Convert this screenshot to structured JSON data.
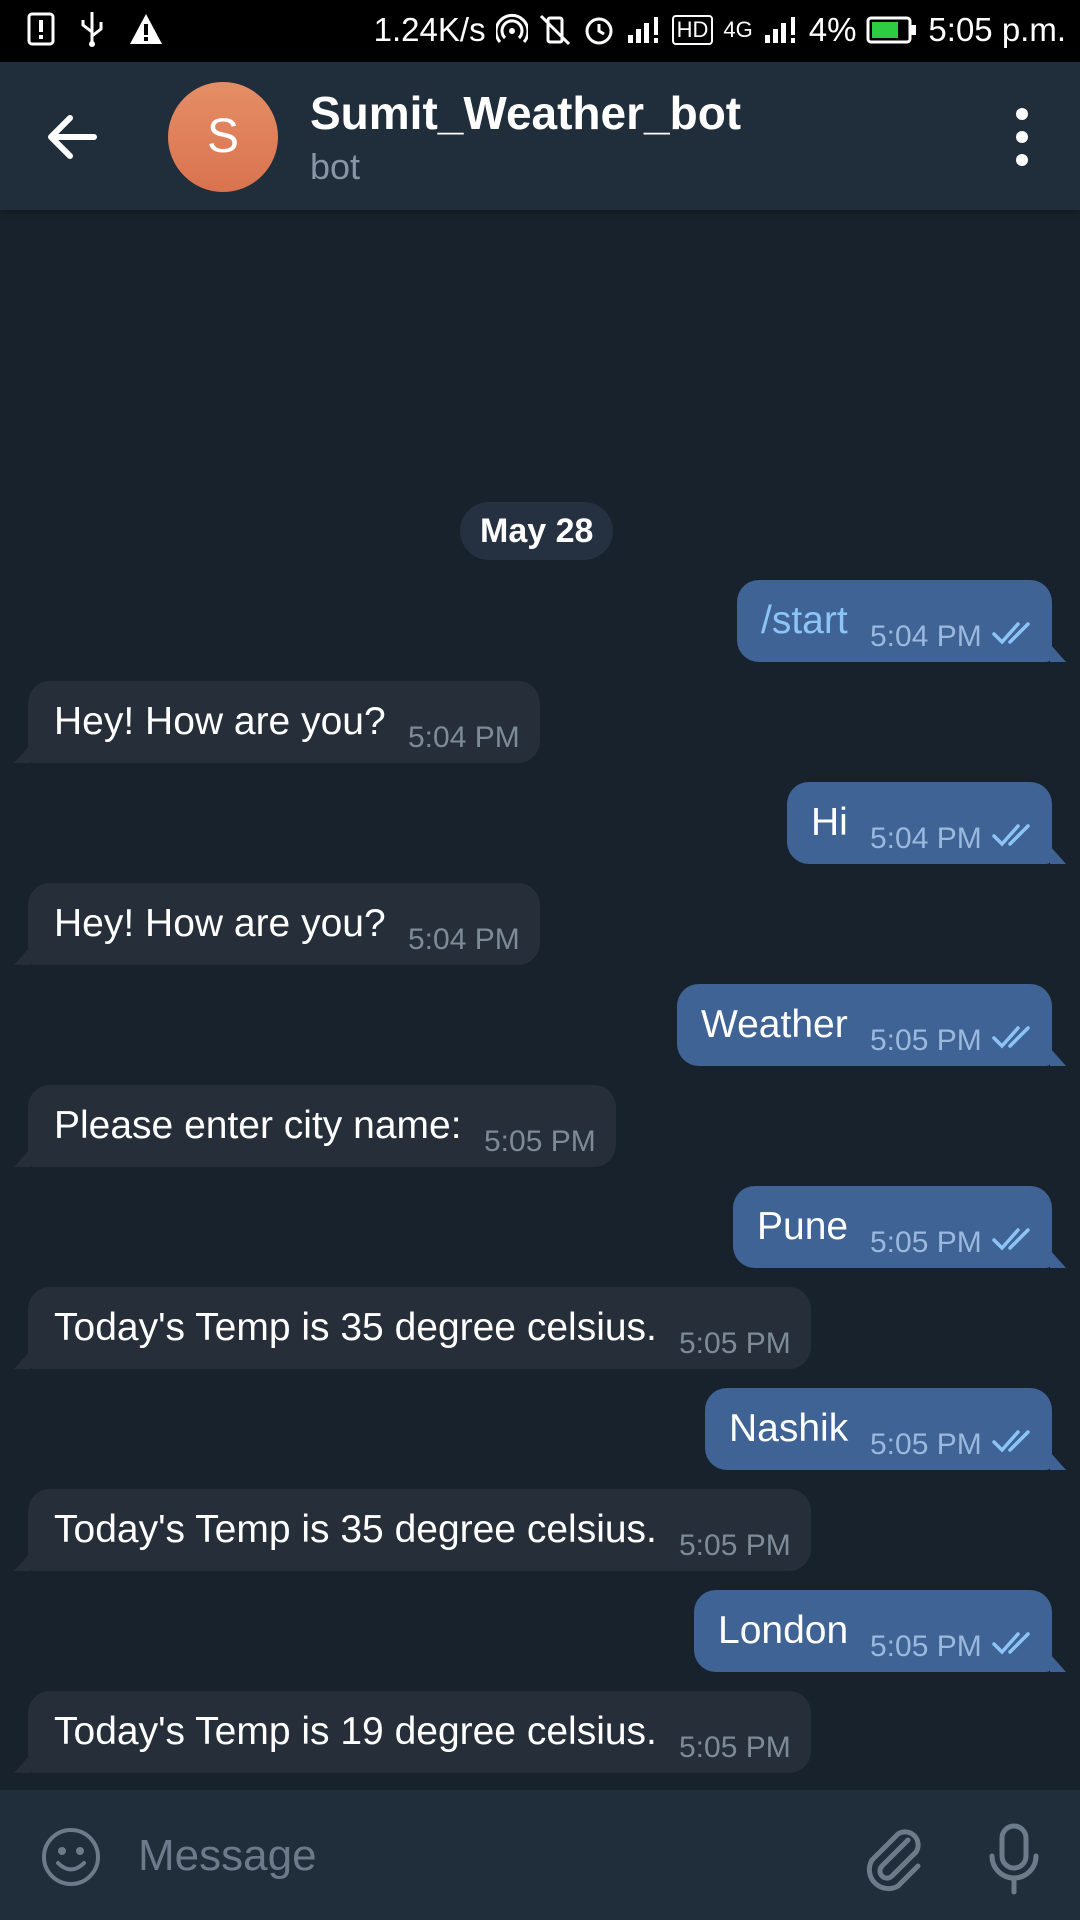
{
  "status_bar": {
    "speed": "1.24K/s",
    "battery_percent": "4%",
    "time": "5:05 p.m.",
    "network": "4G",
    "hd": "HD"
  },
  "toolbar": {
    "avatar_letter": "S",
    "chat_title": "Sumit_Weather_bot",
    "chat_subtitle": "bot"
  },
  "chat": {
    "date_label": "May 28",
    "messages": [
      {
        "dir": "out",
        "text": "/start",
        "time": "5:04 PM"
      },
      {
        "dir": "in",
        "text": "Hey! How are you?",
        "time": "5:04 PM"
      },
      {
        "dir": "out",
        "text": "Hi",
        "time": "5:04 PM"
      },
      {
        "dir": "in",
        "text": "Hey! How are you?",
        "time": "5:04 PM"
      },
      {
        "dir": "out",
        "text": "Weather",
        "time": "5:05 PM"
      },
      {
        "dir": "in",
        "text": "Please enter city name:",
        "time": "5:05 PM"
      },
      {
        "dir": "out",
        "text": "Pune",
        "time": "5:05 PM"
      },
      {
        "dir": "in",
        "text": "Today's Temp is 35 degree celsius.",
        "time": "5:05 PM"
      },
      {
        "dir": "out",
        "text": "Nashik",
        "time": "5:05 PM"
      },
      {
        "dir": "in",
        "text": "Today's Temp is 35 degree celsius.",
        "time": "5:05 PM"
      },
      {
        "dir": "out",
        "text": "London",
        "time": "5:05 PM"
      },
      {
        "dir": "in",
        "text": "Today's Temp is 19 degree celsius.",
        "time": "5:05 PM"
      }
    ]
  },
  "input": {
    "placeholder": "Message",
    "value": ""
  },
  "colors": {
    "background": "#18222d",
    "toolbar": "#202d3b",
    "bubble_in": "#252e39",
    "bubble_out": "#3e6394",
    "avatar": "#e07e5a"
  },
  "icons": [
    "back-arrow-icon",
    "more-vertical-icon",
    "double-check-icon",
    "emoji-icon",
    "paperclip-icon",
    "microphone-icon"
  ]
}
